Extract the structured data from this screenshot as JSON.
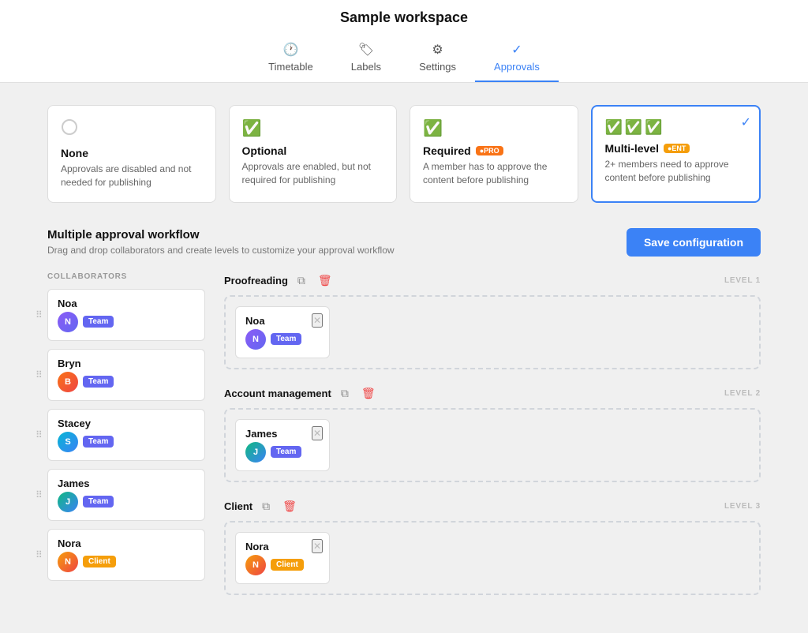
{
  "header": {
    "title": "Sample workspace",
    "tabs": [
      {
        "id": "timetable",
        "label": "Timetable",
        "icon": "🕐",
        "active": false
      },
      {
        "id": "labels",
        "label": "Labels",
        "icon": "🏷",
        "active": false
      },
      {
        "id": "settings",
        "label": "Settings",
        "icon": "⚙",
        "active": false
      },
      {
        "id": "approvals",
        "label": "Approvals",
        "icon": "✓",
        "active": true
      }
    ]
  },
  "approval_cards": [
    {
      "id": "none",
      "title": "None",
      "desc": "Approvals are disabled and not needed for publishing",
      "selected": false,
      "icon": "circle"
    },
    {
      "id": "optional",
      "title": "Optional",
      "desc": "Approvals are enabled, but not required for publishing",
      "selected": false,
      "icon": "green-check"
    },
    {
      "id": "required",
      "title": "Required",
      "badge": "PRO",
      "desc": "A member has to approve the content before publishing",
      "selected": false,
      "icon": "green-check"
    },
    {
      "id": "multilevel",
      "title": "Multi-level",
      "badge": "ENT",
      "desc": "2+ members need to approve content before publishing",
      "selected": true,
      "icon": "multi-check"
    }
  ],
  "workflow": {
    "title": "Multiple approval workflow",
    "desc": "Drag and drop collaborators and create levels to customize your approval workflow",
    "save_btn": "Save configuration"
  },
  "collaborators_label": "COLLABORATORS",
  "collaborators": [
    {
      "id": "noa",
      "name": "Noa",
      "tag": "Team",
      "tag_type": "team",
      "avatar": "noa"
    },
    {
      "id": "bryn",
      "name": "Bryn",
      "tag": "Team",
      "tag_type": "team",
      "avatar": "bryn"
    },
    {
      "id": "stacey",
      "name": "Stacey",
      "tag": "Team",
      "tag_type": "team",
      "avatar": "stacey"
    },
    {
      "id": "james",
      "name": "James",
      "tag": "Team",
      "tag_type": "team",
      "avatar": "james"
    },
    {
      "id": "nora",
      "name": "Nora",
      "tag": "Client",
      "tag_type": "client",
      "avatar": "nora"
    }
  ],
  "levels": [
    {
      "id": "level1",
      "title": "Proofreading",
      "label": "LEVEL 1",
      "members": [
        {
          "id": "noa",
          "name": "Noa",
          "tag": "Team",
          "tag_type": "team",
          "avatar": "noa"
        }
      ]
    },
    {
      "id": "level2",
      "title": "Account management",
      "label": "LEVEL 2",
      "members": [
        {
          "id": "james",
          "name": "James",
          "tag": "Team",
          "tag_type": "team",
          "avatar": "james"
        }
      ]
    },
    {
      "id": "level3",
      "title": "Client",
      "label": "LEVEL 3",
      "members": [
        {
          "id": "nora",
          "name": "Nora",
          "tag": "Client",
          "tag_type": "client",
          "avatar": "nora"
        }
      ]
    }
  ]
}
